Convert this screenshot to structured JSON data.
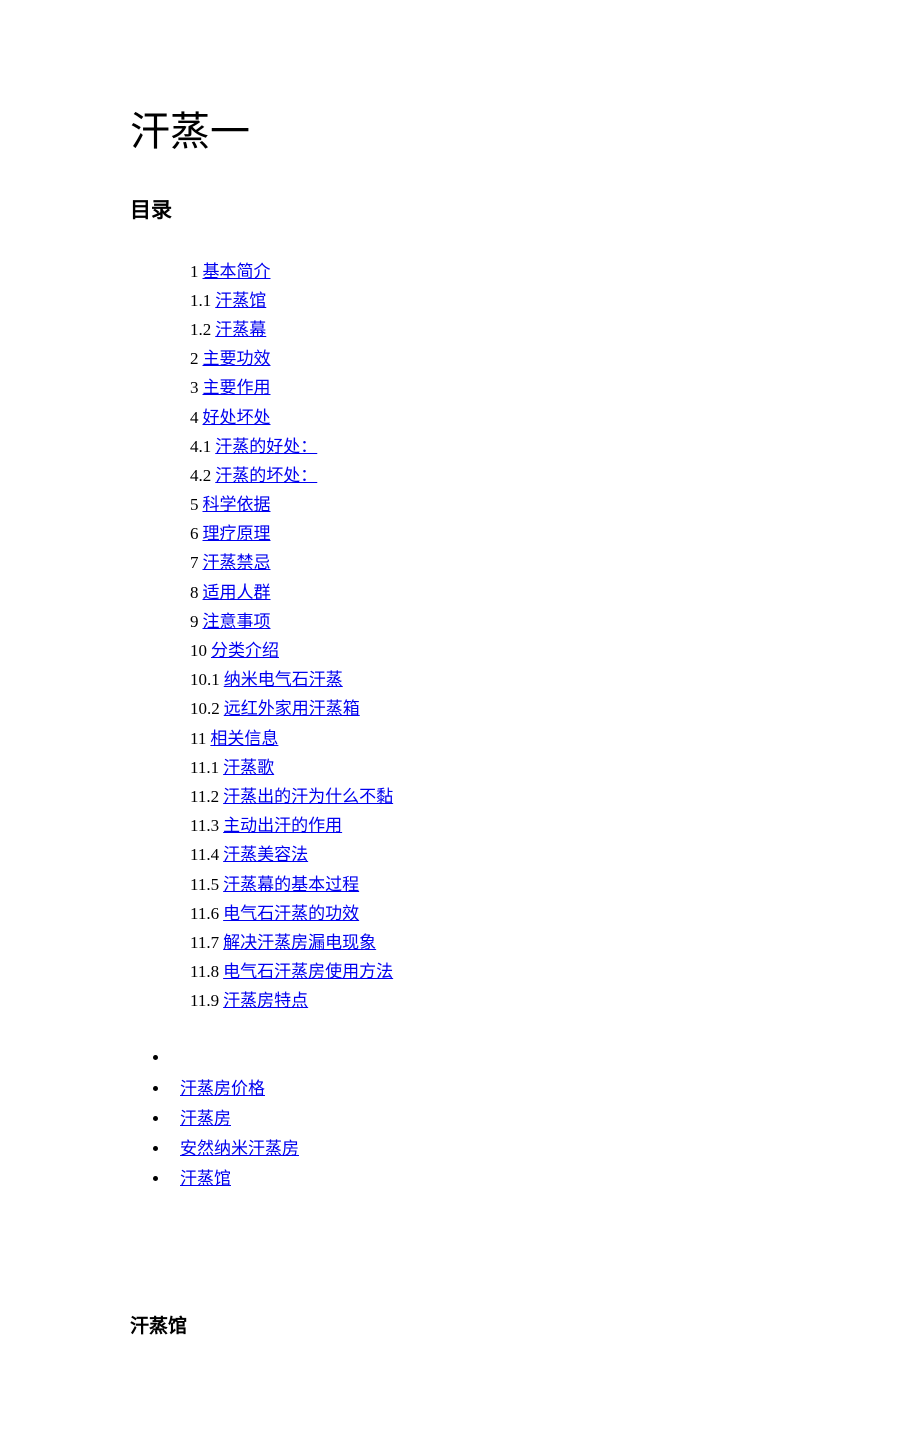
{
  "title": "汗蒸一",
  "toc_heading": "目录",
  "toc": [
    {
      "num": "1",
      "label": "基本简介"
    },
    {
      "num": "1.1",
      "label": "汗蒸馆"
    },
    {
      "num": "1.2",
      "label": "汗蒸幕"
    },
    {
      "num": "2",
      "label": "主要功效"
    },
    {
      "num": "3",
      "label": "主要作用"
    },
    {
      "num": "4",
      "label": "好处坏处"
    },
    {
      "num": "4.1",
      "label": "汗蒸的好处："
    },
    {
      "num": "4.2",
      "label": "汗蒸的坏处："
    },
    {
      "num": "5",
      "label": "科学依据"
    },
    {
      "num": "6",
      "label": "理疗原理"
    },
    {
      "num": "7",
      "label": "汗蒸禁忌"
    },
    {
      "num": "8",
      "label": "适用人群"
    },
    {
      "num": "9",
      "label": "注意事项"
    },
    {
      "num": "10",
      "label": "分类介绍"
    },
    {
      "num": "10.1",
      "label": "纳米电气石汗蒸"
    },
    {
      "num": "10.2",
      "label": "远红外家用汗蒸箱"
    },
    {
      "num": "11",
      "label": "相关信息"
    },
    {
      "num": "11.1",
      "label": "汗蒸歌"
    },
    {
      "num": "11.2",
      "label": "汗蒸出的汗为什么不黏"
    },
    {
      "num": "11.3",
      "label": "主动出汗的作用"
    },
    {
      "num": "11.4",
      "label": "汗蒸美容法"
    },
    {
      "num": "11.5",
      "label": "汗蒸幕的基本过程"
    },
    {
      "num": "11.6",
      "label": "电气石汗蒸的功效"
    },
    {
      "num": "11.7",
      "label": "解决汗蒸房漏电现象"
    },
    {
      "num": "11.8",
      "label": "电气石汗蒸房使用方法"
    },
    {
      "num": "11.9",
      "label": "汗蒸房特点"
    }
  ],
  "related": [
    {
      "label": ""
    },
    {
      "label": "汗蒸房价格"
    },
    {
      "label": "汗蒸房"
    },
    {
      "label": "安然纳米汗蒸房"
    },
    {
      "label": "汗蒸馆"
    }
  ],
  "section_heading": "汗蒸馆"
}
